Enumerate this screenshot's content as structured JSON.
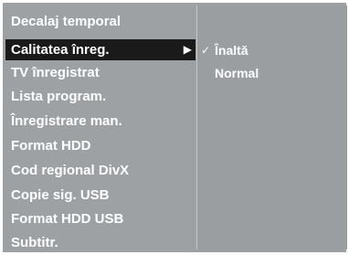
{
  "menu": {
    "items": [
      {
        "label": "Decalaj temporal"
      },
      {
        "label": "Calitatea înreg."
      },
      {
        "label": "TV înregistrat"
      },
      {
        "label": "Lista program."
      },
      {
        "label": "Înregistrare man."
      },
      {
        "label": "Format HDD"
      },
      {
        "label": "Cod regional DivX"
      },
      {
        "label": "Copie sig. USB"
      },
      {
        "label": "Format HDD USB"
      },
      {
        "label": "Subtitr."
      }
    ],
    "selected_index": 1,
    "submenu_arrow_glyph": "▶"
  },
  "submenu": {
    "check_glyph": "✓",
    "options": [
      {
        "label": "Înaltă",
        "checked": true
      },
      {
        "label": "Normal",
        "checked": false
      }
    ]
  },
  "colors": {
    "panel_bg": "#9da1a4",
    "selected_bg": "#1a1a1a",
    "text": "#ffffff"
  }
}
